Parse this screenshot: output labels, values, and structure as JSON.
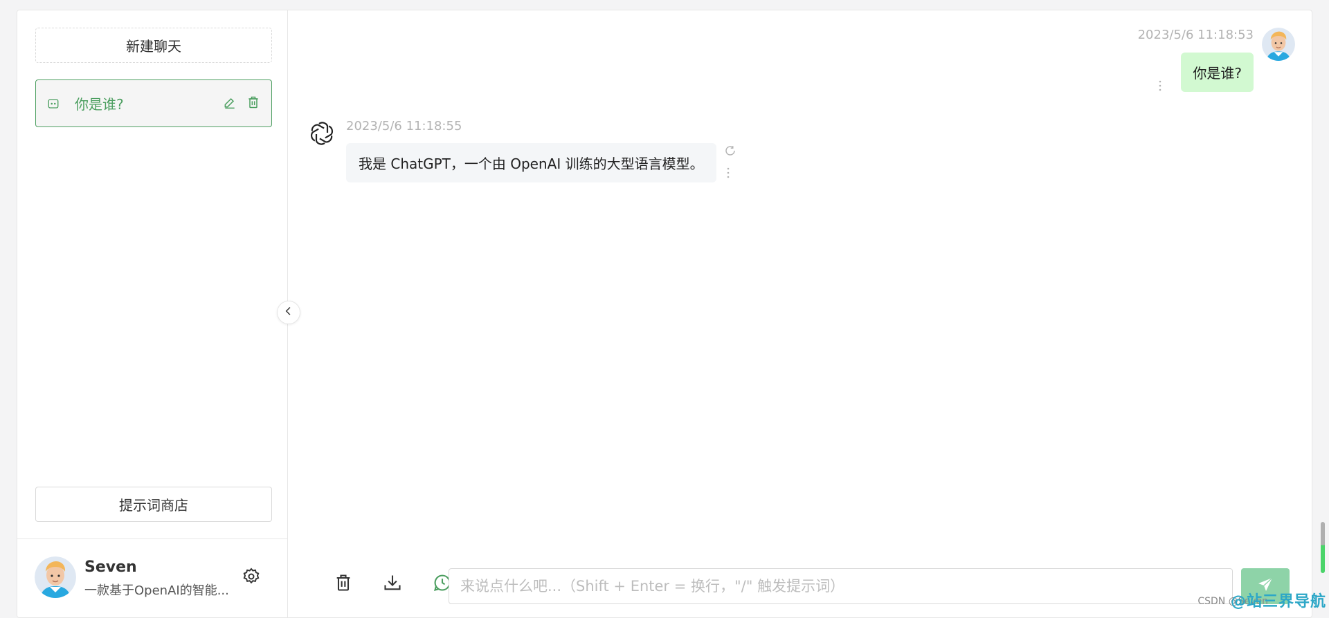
{
  "sidebar": {
    "new_chat_label": "新建聊天",
    "chats": [
      {
        "title": "你是谁?",
        "active": true
      }
    ],
    "prompt_store_label": "提示词商店",
    "user": {
      "name": "Seven",
      "description": "一款基于OpenAI的智能..."
    }
  },
  "messages": [
    {
      "role": "user",
      "time": "2023/5/6 11:18:53",
      "text": "你是谁?"
    },
    {
      "role": "assistant",
      "time": "2023/5/6 11:18:55",
      "text": "我是 ChatGPT，一个由 OpenAI 训练的大型语言模型。"
    }
  ],
  "input": {
    "placeholder": "来说点什么吧...（Shift + Enter = 换行，\"/\" 触发提示词）"
  },
  "watermark": {
    "text": "@站三界导航",
    "sub": "CSDN @Seven"
  },
  "colors": {
    "accent": "#4b9e5f",
    "user_bubble": "#d2f9d1",
    "bot_bubble": "#f4f6f8",
    "send_button": "#8ed3a8"
  }
}
